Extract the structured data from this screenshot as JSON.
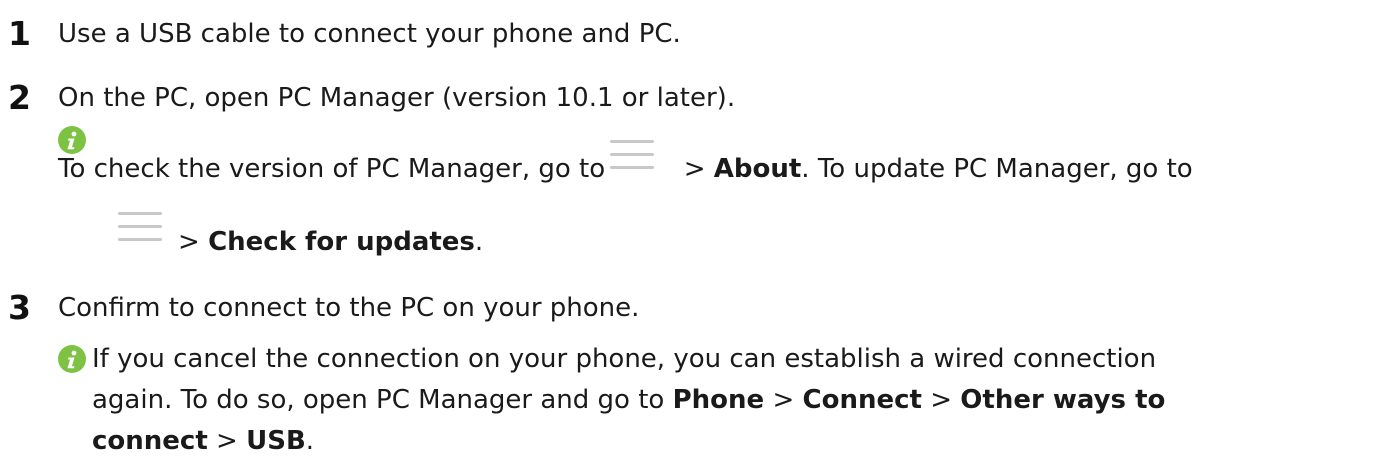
{
  "steps": [
    {
      "number": "1",
      "text": "Use a USB cable to connect your phone and PC."
    },
    {
      "number": "2",
      "text": "On the PC, open PC Manager (version 10.1 or later)."
    },
    {
      "number": "3",
      "text": "Confirm to connect to the PC on your phone."
    }
  ],
  "note1": {
    "line1_a": "To check the version of PC Manager, go to",
    "line1_sep": ">",
    "line1_bold": "About",
    "line1_b": ". To update PC Manager, go to",
    "line2_sep": ">",
    "line2_bold": "Check for updates",
    "line2_end": "."
  },
  "note2": {
    "line1": "If you cancel the connection on your phone, you can establish a wired connection",
    "line2_a": "again. To do so, open PC Manager and go to",
    "line2_bold1": "Phone",
    "line2_sep1": ">",
    "line2_bold2": "Connect",
    "line2_sep2": ">",
    "line2_bold3": "Other ways to",
    "line3_bold": "connect",
    "line3_sep": ">",
    "line3_bold2": "USB",
    "line3_end": "."
  },
  "icons": {
    "info": "info-icon",
    "menu": "menu-icon",
    "info_color": "#7dc243",
    "menu_color": "#c8c8c8"
  }
}
